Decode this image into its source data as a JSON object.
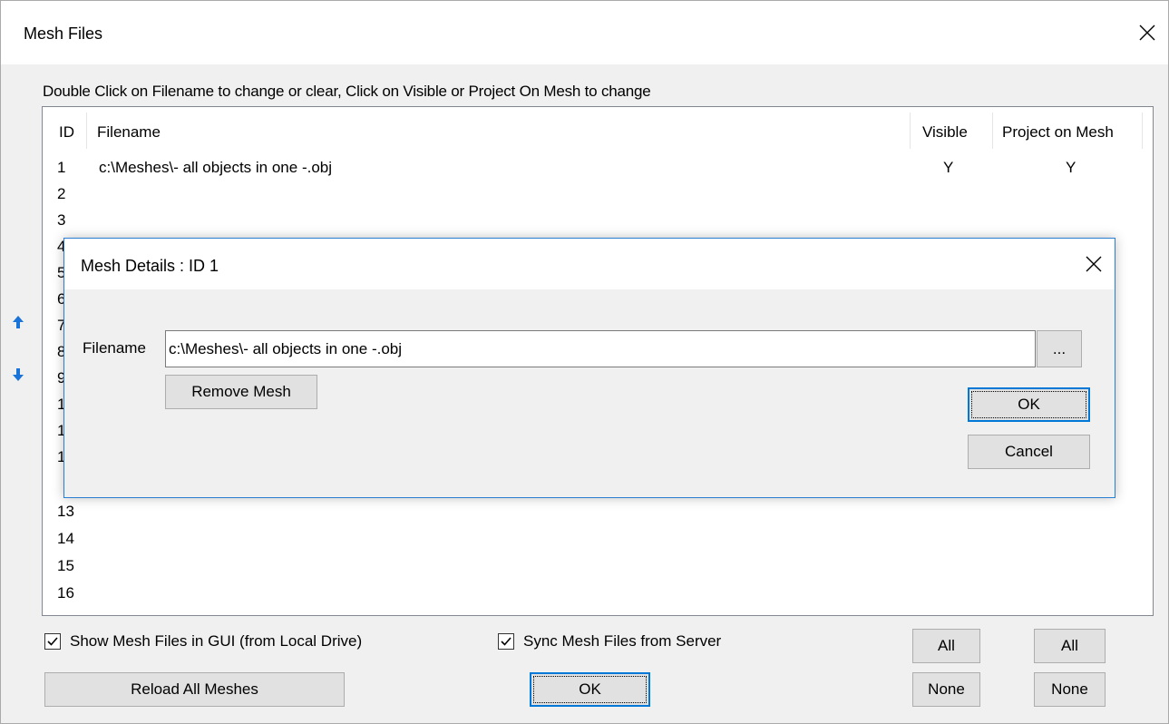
{
  "window": {
    "title": "Mesh Files",
    "instructions": "Double Click on Filename to change or clear, Click on Visible or Project On Mesh to change"
  },
  "table": {
    "columns": [
      "ID",
      "Filename",
      "Visible",
      "Project on Mesh"
    ],
    "first_row": {
      "id": "1",
      "filename": "c:\\Meshes\\- all objects in one -.obj",
      "visible": "Y",
      "project": "Y"
    },
    "ids_visible": [
      "2",
      "3",
      "4",
      "5",
      "6",
      "7",
      "8",
      "9",
      "1",
      "1",
      "1",
      "13",
      "14",
      "15",
      "16"
    ]
  },
  "bottom": {
    "show_mesh_label": "Show Mesh Files in GUI (from Local Drive)",
    "sync_label": "Sync Mesh Files from Server",
    "reload_label": "Reload All Meshes",
    "ok_label": "OK",
    "visible_all_label": "All",
    "visible_none_label": "None",
    "project_all_label": "All",
    "project_none_label": "None"
  },
  "modal": {
    "title": "Mesh Details : ID 1",
    "filename_label": "Filename",
    "filename_value": "c:\\Meshes\\- all objects in one -.obj",
    "browse_label": "...",
    "remove_label": "Remove Mesh",
    "ok_label": "OK",
    "cancel_label": "Cancel"
  },
  "icons": {
    "move_up": "arrow-up-icon",
    "move_down": "arrow-down-icon",
    "close": "close-icon",
    "checkbox": "checkmark-icon"
  },
  "colors": {
    "accent": "#0078d7",
    "arrow": "#1a73d9",
    "dialog_bg": "#f0f0f0"
  }
}
